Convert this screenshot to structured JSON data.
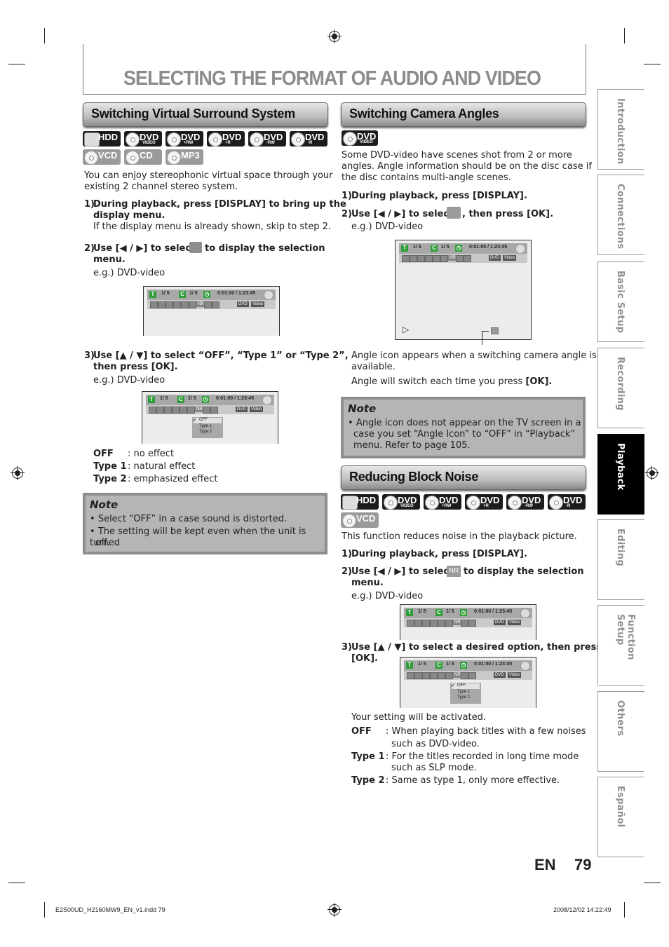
{
  "page": {
    "title": "SELECTING THE FORMAT OF AUDIO AND VIDEO",
    "lang_code": "EN",
    "page_number": "79"
  },
  "left": {
    "section_title": "Switching Virtual Surround System",
    "media_badges_row1": [
      {
        "label": "HDD",
        "sub": "",
        "style": "black"
      },
      {
        "label": "DVD",
        "sub": "VIDEO",
        "style": "black"
      },
      {
        "label": "DVD",
        "sub": "+RW",
        "style": "black"
      },
      {
        "label": "DVD",
        "sub": "+R",
        "style": "black"
      },
      {
        "label": "DVD",
        "sub": "-RW",
        "style": "black"
      },
      {
        "label": "DVD",
        "sub": "-R",
        "style": "black"
      }
    ],
    "media_badges_row2": [
      {
        "label": "VCD",
        "sub": "",
        "style": "gray"
      },
      {
        "label": "CD",
        "sub": "",
        "style": "gray"
      },
      {
        "label": "MP3",
        "sub": "",
        "style": "gray"
      }
    ],
    "intro_line1": "You can enjoy stereophonic virtual space through your",
    "intro_line2": "existing 2 channel stereo system.",
    "step1": {
      "num": "1)",
      "line1": "During playback, press [DISPLAY] to bring up the",
      "line2": "display menu.",
      "note": "If the display menu is already shown, skip to step 2."
    },
    "step2": {
      "num": "2)",
      "pre": "Use [◀ / ▶] to select",
      "post": "to display the selection",
      "line2": "menu.",
      "eg": "e.g.) DVD-video"
    },
    "step3": {
      "num": "3)",
      "line1": "Use [▲ / ▼] to select “OFF”, “Type 1” or “Type 2”,",
      "line2": "then press [OK].",
      "eg": "e.g.) DVD-video"
    },
    "options": [
      {
        "key": "OFF",
        "desc": ": no effect"
      },
      {
        "key": "Type 1",
        "desc": ": natural effect"
      },
      {
        "key": "Type 2",
        "desc": ": emphasized effect"
      }
    ],
    "note": {
      "title": "Note",
      "items": [
        "Select “OFF” in a case sound is distorted.",
        "The setting will be kept even when the unit is turned",
        "off."
      ]
    }
  },
  "osd": {
    "title_icon": "T",
    "title_val": "1/   5",
    "chapter_icon": "C",
    "chapter_val": "1/   5",
    "time": "0:01:00 / 1:23:45",
    "nr_label": "NR",
    "dvd_tag": "DVD",
    "video_tag": "Video",
    "menu_items": [
      "OFF",
      "Type 1",
      "Type 2"
    ],
    "check": "✔",
    "play_glyph": "▷"
  },
  "right": {
    "section1_title": "Switching Camera Angles",
    "badge": {
      "label": "DVD",
      "sub": "VIDEO"
    },
    "intro_lines": [
      "Some DVD-video have scenes shot from 2 or more",
      "angles. Angle information should be on the disc case if",
      "the disc contains multi-angle scenes."
    ],
    "step1": {
      "num": "1)",
      "text": "During playback, press [DISPLAY]."
    },
    "step2": {
      "num": "2)",
      "pre": "Use [◀ / ▶] to select",
      "post": ", then press [OK].",
      "eg": "e.g.) DVD-video"
    },
    "caption1_line1": "Angle icon appears when a switching camera angle is",
    "caption1_line2": "available.",
    "caption2_pre": "Angle will switch each time you press",
    "caption2_bold": "[OK].",
    "note": {
      "title": "Note",
      "items": [
        "Angle icon does not appear on the TV screen in a",
        "case you set “Angle Icon” to “OFF” in “Playback”",
        "menu. Refer to page 105."
      ]
    },
    "section2_title": "Reducing Block Noise",
    "media_badges_row1": [
      {
        "label": "HDD",
        "sub": ""
      },
      {
        "label": "DVD",
        "sub": "VIDEO"
      },
      {
        "label": "DVD",
        "sub": "+RW"
      },
      {
        "label": "DVD",
        "sub": "+R"
      },
      {
        "label": "DVD",
        "sub": "-RW"
      },
      {
        "label": "DVD",
        "sub": "-R"
      }
    ],
    "media_badges_row2": [
      {
        "label": "VCD",
        "sub": ""
      }
    ],
    "nr_intro": "This function reduces noise in the playback picture.",
    "nr_step1": {
      "num": "1)",
      "text": "During playback, press [DISPLAY]."
    },
    "nr_step2": {
      "num": "2)",
      "pre": "Use [◀ / ▶] to select",
      "icon": "NR",
      "post": "to display the selection",
      "line2": "menu.",
      "eg": "e.g.) DVD-video"
    },
    "nr_step3": {
      "num": "3)",
      "line1": "Use [▲ / ▼] to select a desired option, then press",
      "line2": "[OK]."
    },
    "activated": "Your setting will be activated.",
    "options": [
      {
        "key": "OFF",
        "desc1": ": When playing back titles with a few noises",
        "desc2": "such as DVD-video."
      },
      {
        "key": "Type 1",
        "desc1": ": For the titles recorded in long time mode",
        "desc2": "such as SLP mode."
      },
      {
        "key": "Type 2",
        "desc1": ": Same as type 1, only more effective.",
        "desc2": ""
      }
    ]
  },
  "side_tabs": [
    {
      "label": "Introduction",
      "active": false
    },
    {
      "label": "Connections",
      "active": false
    },
    {
      "label": "Basic Setup",
      "active": false
    },
    {
      "label": "Recording",
      "active": false
    },
    {
      "label": "Playback",
      "active": true
    },
    {
      "label": "Editing",
      "active": false
    },
    {
      "label": "Function Setup",
      "active": false
    },
    {
      "label": "Others",
      "active": false
    },
    {
      "label": "Español",
      "active": false
    }
  ],
  "footer": {
    "file": "E2S00UD_H2160MW9_EN_v1.indd   79",
    "timestamp": "2008/12/02   14:22:49"
  }
}
